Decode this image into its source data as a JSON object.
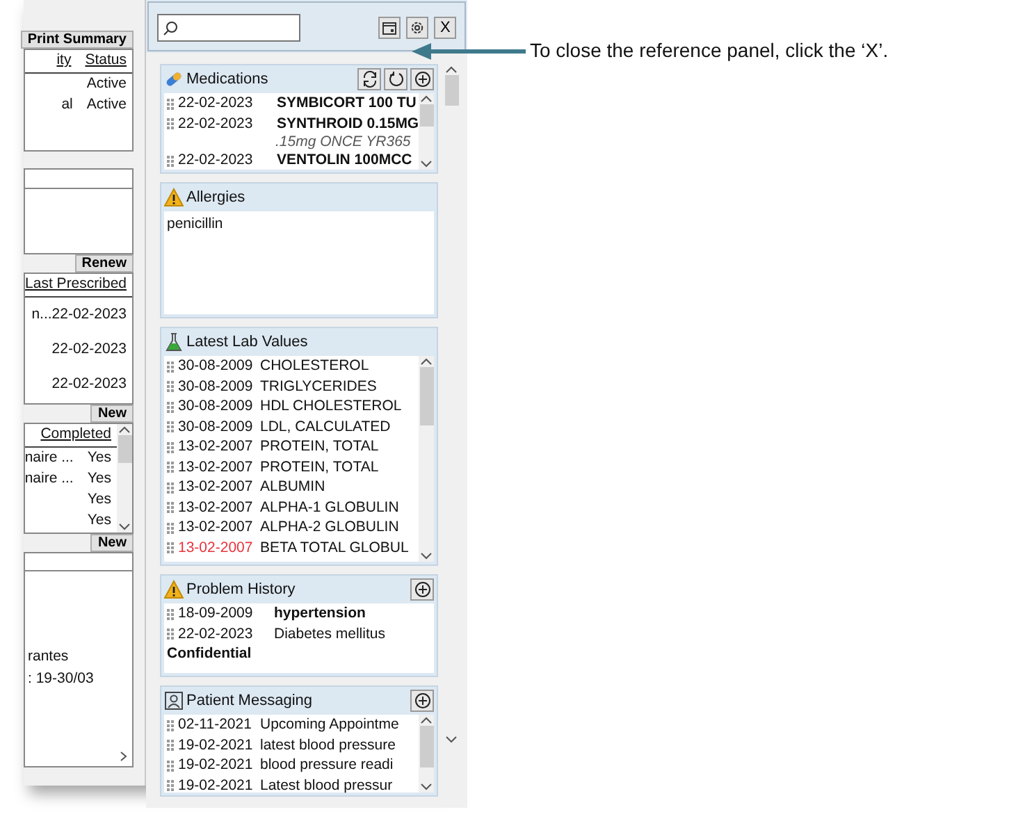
{
  "app_strip": {
    "sections": [
      {
        "kind": "table",
        "button": "Print Summary",
        "columns": [
          "ity",
          "Status"
        ],
        "rows": [
          [
            "",
            "Active"
          ],
          [
            "al",
            "Active"
          ]
        ]
      },
      {
        "kind": "blank"
      },
      {
        "kind": "table",
        "button": "Renew",
        "columns": [
          "Last Prescribed"
        ],
        "rows": [
          [
            "n...22-02-2023"
          ],
          [
            "22-02-2023"
          ],
          [
            "22-02-2023"
          ]
        ]
      },
      {
        "kind": "table",
        "button": "New",
        "columns": [
          "Completed"
        ],
        "rows": [
          [
            "naire ...",
            "Yes"
          ],
          [
            "naire ...",
            "Yes"
          ],
          [
            "Yes"
          ],
          [
            "Yes"
          ]
        ]
      },
      {
        "kind": "notes",
        "button": "New",
        "lines": [
          "rantes",
          ": 19-30/03"
        ]
      }
    ]
  },
  "reference_panel": {
    "toolbar": {
      "close_label": "X"
    },
    "sections": [
      {
        "kind": "medications",
        "title": "Medications",
        "items": [
          {
            "date": "22-02-2023",
            "name": "SYMBICORT 100 TU"
          },
          {
            "date": "22-02-2023",
            "name": "SYNTHROID 0.15MG",
            "detail": ".15mg ONCE YR365"
          },
          {
            "date": "22-02-2023",
            "name": "VENTOLIN 100MCC"
          }
        ]
      },
      {
        "kind": "allergies",
        "title": "Allergies",
        "text": "penicillin"
      },
      {
        "kind": "labs",
        "title": "Latest Lab Values",
        "items": [
          {
            "date": "30-08-2009",
            "name": "CHOLESTEROL",
            "flagged": false
          },
          {
            "date": "30-08-2009",
            "name": "TRIGLYCERIDES",
            "flagged": false
          },
          {
            "date": "30-08-2009",
            "name": "HDL CHOLESTEROL",
            "flagged": false
          },
          {
            "date": "30-08-2009",
            "name": "LDL, CALCULATED",
            "flagged": false
          },
          {
            "date": "13-02-2007",
            "name": "PROTEIN, TOTAL",
            "flagged": false
          },
          {
            "date": "13-02-2007",
            "name": "PROTEIN, TOTAL",
            "flagged": false
          },
          {
            "date": "13-02-2007",
            "name": "ALBUMIN",
            "flagged": false
          },
          {
            "date": "13-02-2007",
            "name": "ALPHA-1 GLOBULIN",
            "flagged": false
          },
          {
            "date": "13-02-2007",
            "name": "ALPHA-2 GLOBULIN",
            "flagged": false
          },
          {
            "date": "13-02-2007",
            "name": "BETA TOTAL GLOBUL",
            "flagged": true
          }
        ]
      },
      {
        "kind": "problems",
        "title": "Problem History",
        "items": [
          {
            "date": "18-09-2009",
            "name": "hypertension",
            "bold": true
          },
          {
            "date": "22-02-2023",
            "name": "Diabetes mellitus",
            "bold": false
          }
        ],
        "footer": "Confidential"
      },
      {
        "kind": "messaging",
        "title": "Patient Messaging",
        "items": [
          {
            "date": "02-11-2021",
            "name": "Upcoming Appointme"
          },
          {
            "date": "19-02-2021",
            "name": "latest blood pressure"
          },
          {
            "date": "19-02-2021",
            "name": "blood pressure readi"
          },
          {
            "date": "19-02-2021",
            "name": "Latest blood pressur"
          }
        ]
      }
    ]
  },
  "callout": {
    "text": "To close the reference panel, click the ‘X’."
  }
}
